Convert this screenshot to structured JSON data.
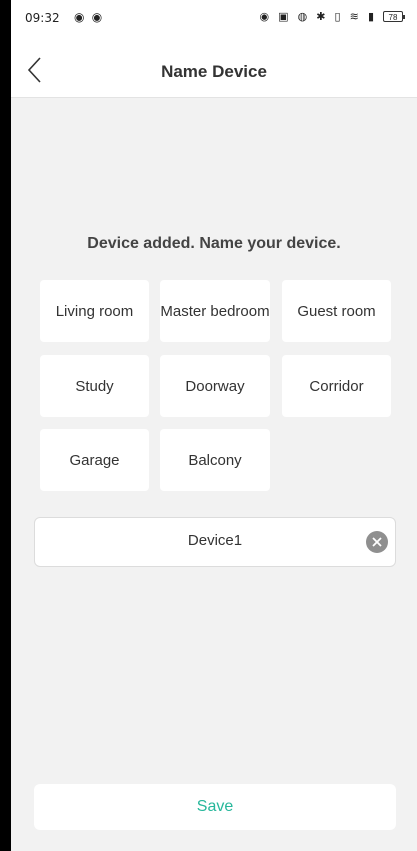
{
  "status_bar": {
    "time": "09:32",
    "left_icons": "◉ ◉",
    "right_icons": "◉ ▣ ◍ ✱ ▯ ≋ ▮",
    "battery": "78"
  },
  "header": {
    "title": "Name Device",
    "back_icon": "chevron-left-icon"
  },
  "prompt": "Device added. Name your device.",
  "room_options": [
    "Living room",
    "Master bedroom",
    "Guest room",
    "Study",
    "Doorway",
    "Corridor",
    "Garage",
    "Balcony"
  ],
  "name_field": {
    "value": "Device1",
    "clear_icon": "clear-icon"
  },
  "save_label": "Save",
  "colors": {
    "accent": "#27b79b",
    "background": "#f2f2f2",
    "surface": "#ffffff"
  }
}
